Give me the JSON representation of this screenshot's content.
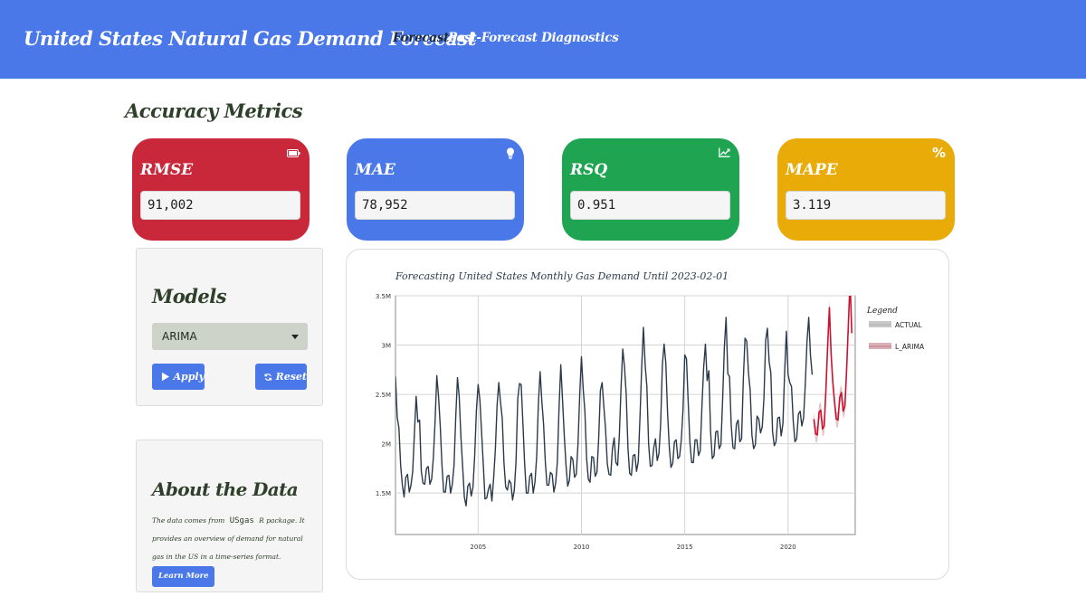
{
  "header": {
    "brand": "United States Natural Gas Demand Forecast",
    "nav": [
      "Forecast",
      "Post-Forecast Diagnostics"
    ],
    "bg": "#4a78e8"
  },
  "section_title": "Accuracy Metrics",
  "metrics": [
    {
      "label": "RMSE",
      "value": "91,002",
      "color": "#c8283a",
      "icon": "battery-icon"
    },
    {
      "label": "MAE",
      "value": "78,952",
      "color": "#4a78e8",
      "icon": "lightbulb-icon"
    },
    {
      "label": "RSQ",
      "value": "0.951",
      "color": "#1fa452",
      "icon": "chart-line-icon"
    },
    {
      "label": "MAPE",
      "value": "3.119",
      "color": "#e8ab08",
      "icon": "percent-icon"
    }
  ],
  "models": {
    "title": "Models",
    "selected": "ARIMA",
    "apply_label": "Apply",
    "reset_label": "Reset"
  },
  "about": {
    "title": "About the Data",
    "text_before": "The data comes from",
    "package": "USgas",
    "text_after": "R package. It provides an overview of demand for natural gas in the US in a time-series format.",
    "learn_more": "Learn More"
  },
  "chart_data": {
    "type": "line",
    "title": "Forecasting United States Monthly Gas Demand Until 2023-02-01",
    "x_ticks": [
      2005,
      2010,
      2015,
      2020
    ],
    "y_ticks": [
      "1.5M",
      "2M",
      "2.5M",
      "3M",
      "3.5M"
    ],
    "y_tick_values": [
      1500000,
      2000000,
      2500000,
      3000000,
      3500000
    ],
    "xlim": [
      2001.0,
      2023.25
    ],
    "ylim": [
      1080000,
      3500000
    ],
    "legend_title": "Legend",
    "grid": true,
    "legend_position": "right",
    "series": [
      {
        "name": "ACTUAL",
        "color": "#2b3a4b",
        "start": 2001.0,
        "step": 0.0833333,
        "values": [
          2680000,
          2270000,
          2160000,
          1780000,
          1580000,
          1460000,
          1660000,
          1690000,
          1510000,
          1580000,
          1720000,
          2110000,
          2480000,
          2220000,
          2240000,
          1720000,
          1600000,
          1590000,
          1750000,
          1770000,
          1590000,
          1640000,
          1860000,
          2230000,
          2690000,
          2480000,
          2180000,
          1780000,
          1510000,
          1510000,
          1670000,
          1680000,
          1500000,
          1590000,
          1780000,
          2270000,
          2670000,
          2480000,
          2070000,
          1770000,
          1460000,
          1370000,
          1570000,
          1600000,
          1470000,
          1560000,
          1880000,
          2340000,
          2600000,
          2450000,
          2120000,
          1790000,
          1440000,
          1450000,
          1540000,
          1590000,
          1420000,
          1650000,
          1940000,
          2390000,
          2620000,
          2420000,
          2260000,
          1810000,
          1560000,
          1530000,
          1630000,
          1600000,
          1430000,
          1530000,
          1820000,
          2450000,
          2610000,
          2600000,
          2210000,
          1800000,
          1500000,
          1500000,
          1670000,
          1700000,
          1500000,
          1610000,
          1870000,
          2410000,
          2730000,
          2430000,
          2200000,
          1820000,
          1580000,
          1580000,
          1710000,
          1690000,
          1510000,
          1600000,
          1810000,
          2370000,
          2800000,
          2450000,
          2090000,
          1790000,
          1570000,
          1630000,
          1870000,
          1840000,
          1660000,
          1690000,
          2000000,
          2500000,
          2880000,
          2560000,
          2330000,
          1850000,
          1640000,
          1610000,
          1870000,
          1860000,
          1670000,
          1710000,
          2050000,
          2540000,
          2620000,
          2380000,
          2150000,
          1800000,
          1690000,
          1680000,
          1950000,
          2060000,
          1810000,
          1780000,
          2080000,
          2570000,
          2960000,
          2780000,
          2500000,
          1960000,
          1700000,
          1680000,
          1880000,
          1890000,
          1720000,
          1820000,
          2270000,
          2780000,
          3180000,
          2800000,
          2580000,
          2000000,
          1770000,
          1780000,
          1960000,
          2050000,
          1830000,
          1900000,
          2200000,
          2800000,
          3010000,
          2820000,
          2320000,
          1970000,
          1760000,
          1800000,
          2020000,
          2040000,
          1850000,
          1870000,
          2040000,
          2350000,
          2900000,
          2860000,
          2420000,
          2010000,
          1810000,
          1810000,
          2040000,
          2040000,
          1880000,
          1930000,
          2390000,
          2780000,
          3010000,
          2640000,
          2740000,
          2120000,
          1850000,
          1880000,
          2120000,
          2130000,
          1950000,
          1990000,
          2450000,
          2980000,
          3280000,
          2710000,
          2680000,
          2180000,
          1960000,
          1950000,
          2200000,
          2240000,
          2020000,
          2050000,
          2650000,
          3070000,
          3040000,
          2720000,
          2540000,
          2090000,
          1950000,
          1990000,
          2280000,
          2250000,
          2110000,
          2170000,
          2470000,
          3050000,
          3170000,
          2830000,
          2720000,
          2120000,
          1980000,
          2020000,
          2260000,
          2270000,
          2080000,
          2200000,
          2720000,
          3140000,
          2700000,
          2620000,
          2580000,
          2230000,
          2020000,
          2050000,
          2300000,
          2330000,
          2180000,
          2260000,
          2600000,
          3040000,
          3280000,
          2900000,
          2700000
        ]
      },
      {
        "name": "L_ARIMA",
        "color": "#d0102e",
        "start": 2021.25,
        "step": 0.0833333,
        "values": [
          2250000,
          2100000,
          2090000,
          2320000,
          2340000,
          2150000,
          2180000,
          2560000,
          3000000,
          3380000,
          2910000,
          2620000,
          2420000,
          2250000,
          2240000,
          2470000,
          2520000,
          2330000,
          2380000,
          2750000,
          3200000,
          3650000,
          3120000
        ],
        "band_half_width": 80000,
        "band_color": "#d8b0b6"
      }
    ]
  }
}
